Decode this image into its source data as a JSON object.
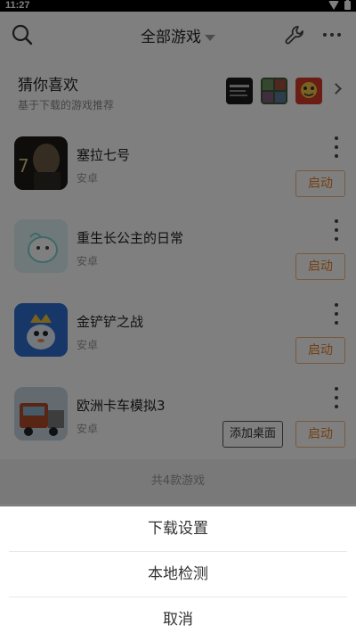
{
  "status": {
    "time": "11:27"
  },
  "header": {
    "title": "全部游戏"
  },
  "recommend": {
    "title": "猜你喜欢",
    "subtitle": "基于下载的游戏推荐"
  },
  "games": [
    {
      "name": "塞拉七号",
      "platform": "安卓",
      "launch": "启动"
    },
    {
      "name": "重生长公主的日常",
      "platform": "安卓",
      "launch": "启动"
    },
    {
      "name": "金铲铲之战",
      "platform": "安卓",
      "launch": "启动"
    },
    {
      "name": "欧洲卡车模拟3",
      "platform": "安卓",
      "launch": "启动",
      "add_desktop": "添加桌面"
    }
  ],
  "footer": {
    "count_text": "共4款游戏"
  },
  "sheet": {
    "download_settings": "下载设置",
    "local_check": "本地检测",
    "cancel": "取消"
  },
  "colors": {
    "accent": "#e67e22",
    "overlay": "rgba(0,0,0,0.5)"
  }
}
